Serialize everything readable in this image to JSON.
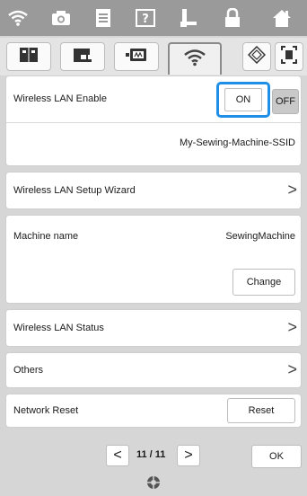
{
  "status_icons": [
    "wifi-icon",
    "camera-icon",
    "document-icon",
    "help-icon",
    "sewing-foot-icon",
    "lock-icon",
    "home-icon"
  ],
  "tabs": [
    "book-icon",
    "sewing-machine-icon",
    "embroidery-frame-icon",
    "wifi-icon",
    "settings-diamond-icon",
    "screen-frame-icon"
  ],
  "wlan_enable": {
    "label": "Wireless LAN Enable",
    "on": "ON",
    "off": "OFF",
    "state": "ON"
  },
  "ssid": "My-Sewing-Machine-SSID",
  "setup_wizard": {
    "label": "Wireless LAN Setup Wizard",
    "chev": ">"
  },
  "machine_name": {
    "label": "Machine name",
    "value": "SewingMachine",
    "change": "Change"
  },
  "wlan_status": {
    "label": "Wireless LAN Status",
    "chev": ">"
  },
  "others": {
    "label": "Others",
    "chev": ">"
  },
  "network_reset": {
    "label": "Network Reset",
    "reset": "Reset"
  },
  "pager": {
    "prev": "<",
    "text": "11 / 11",
    "next": ">",
    "ok": "OK"
  },
  "colors": {
    "highlight": "#1e8ee6"
  }
}
